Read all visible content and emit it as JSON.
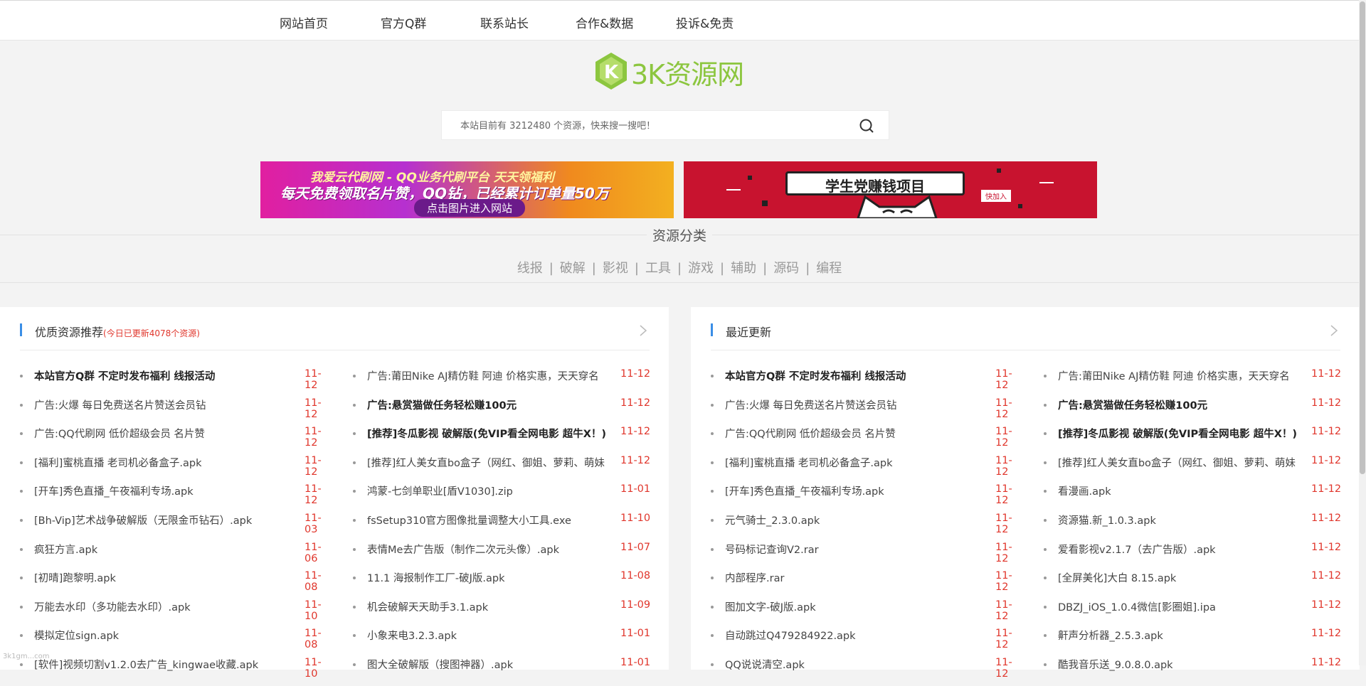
{
  "nav": {
    "items": [
      {
        "label": "网站首页"
      },
      {
        "label": "官方Q群"
      },
      {
        "label": "联系站长"
      },
      {
        "label": "合作&数据"
      },
      {
        "label": "投诉&免责"
      }
    ]
  },
  "logo": {
    "text": "3K资源网",
    "mark": "K",
    "color": "#8cc63f"
  },
  "search": {
    "placeholder": "本站目前有 3212480 个资源，快来搜一搜吧！",
    "icon": "search-icon"
  },
  "banners": {
    "b1": {
      "line1": "我爱云代刷网 - QQ业务代刷平台   天天领福利",
      "line2": "每天免费领取名片赞，QQ钻，已经累计订单量50万",
      "button": "点击图片进入网站"
    },
    "b2": {
      "text": "学生党赚钱项目",
      "tag": "快加入"
    }
  },
  "categories": {
    "title": "资源分类",
    "links": [
      "线报",
      "破解",
      "影视",
      "工具",
      "游戏",
      "辅助",
      "源码",
      "编程"
    ]
  },
  "left_panel": {
    "title": "优质资源推荐",
    "subtitle": "(今日已更新4078个资源)",
    "col_a": [
      {
        "title": "本站官方Q群 不定时发布福利 线报活动",
        "date": "11-12",
        "bold": true
      },
      {
        "title": "广告:火爆 每日免费送名片赞送会员钻",
        "date": "11-12"
      },
      {
        "title": "广告:QQ代刷网  低价超级会员 名片赞",
        "date": "11-12"
      },
      {
        "title": "[福利]蜜桃直播 老司机必备盒子.apk",
        "date": "11-12"
      },
      {
        "title": "[开车]秀色直播_午夜福利专场.apk",
        "date": "11-12"
      },
      {
        "title": "[Bh-Vip]艺术战争破解版（无限金币钻石）.apk",
        "date": "11-03"
      },
      {
        "title": "疯狂方言.apk",
        "date": "11-06"
      },
      {
        "title": "[初晴]跑黎明.apk",
        "date": "11-08"
      },
      {
        "title": "万能去水印（多功能去水印）.apk",
        "date": "11-10"
      },
      {
        "title": "模拟定位sign.apk",
        "date": "11-08"
      },
      {
        "title": "[软件]视频切割v1.2.0去广告_kingwae收藏.apk",
        "date": "11-10"
      }
    ],
    "col_b": [
      {
        "title": "广告:莆田Nike AJ精仿鞋 阿迪 价格实惠，天天穿名",
        "date": "11-12"
      },
      {
        "title": "广告:悬赏猫做任务轻松赚100元",
        "date": "11-12",
        "bold": true
      },
      {
        "title": "[推荐]冬瓜影视 破解版(免VIP看全网电影 超牛X！)",
        "date": "11-12",
        "bold": true
      },
      {
        "title": "[推荐]红人美女直bo盒子（网红、御姐、萝莉、萌妹",
        "date": "11-12"
      },
      {
        "title": "鸿蒙-七剑单职业[盾V1030].zip",
        "date": "11-01"
      },
      {
        "title": "fsSetup310官方图像批量调整大小工具.exe",
        "date": "11-10"
      },
      {
        "title": "表情Me去广告版（制作二次元头像）.apk",
        "date": "11-07"
      },
      {
        "title": "11.1 海报制作工厂-破J版.apk",
        "date": "11-08"
      },
      {
        "title": "机会破解天天助手3.1.apk",
        "date": "11-09"
      },
      {
        "title": "小象来电3.2.3.apk",
        "date": "11-01"
      },
      {
        "title": "图大全破解版（搜图神器）.apk",
        "date": "11-01"
      }
    ]
  },
  "right_panel": {
    "title": "最近更新",
    "col_a": [
      {
        "title": "本站官方Q群 不定时发布福利 线报活动",
        "date": "11-12",
        "bold": true
      },
      {
        "title": "广告:火爆 每日免费送名片赞送会员钻",
        "date": "11-12"
      },
      {
        "title": "广告:QQ代刷网  低价超级会员 名片赞",
        "date": "11-12"
      },
      {
        "title": "[福利]蜜桃直播 老司机必备盒子.apk",
        "date": "11-12"
      },
      {
        "title": "[开车]秀色直播_午夜福利专场.apk",
        "date": "11-12"
      },
      {
        "title": "元气骑士_2.3.0.apk",
        "date": "11-12"
      },
      {
        "title": "号码标记查询V2.rar",
        "date": "11-12"
      },
      {
        "title": "内部程序.rar",
        "date": "11-12"
      },
      {
        "title": "图加文字-破J版.apk",
        "date": "11-12"
      },
      {
        "title": "自动跳过Q479284922.apk",
        "date": "11-12"
      },
      {
        "title": "QQ说说清空.apk",
        "date": "11-12"
      }
    ],
    "col_b": [
      {
        "title": "广告:莆田Nike AJ精仿鞋 阿迪 价格实惠，天天穿名",
        "date": "11-12"
      },
      {
        "title": "广告:悬赏猫做任务轻松赚100元",
        "date": "11-12",
        "bold": true
      },
      {
        "title": "[推荐]冬瓜影视 破解版(免VIP看全网电影 超牛X！)",
        "date": "11-12",
        "bold": true
      },
      {
        "title": "[推荐]红人美女直bo盒子（网红、御姐、萝莉、萌妹",
        "date": "11-12"
      },
      {
        "title": "看漫画.apk",
        "date": "11-12"
      },
      {
        "title": "资源猫.新_1.0.3.apk",
        "date": "11-12"
      },
      {
        "title": "爱看影视v2.1.7（去广告版）.apk",
        "date": "11-12"
      },
      {
        "title": "[全屏美化]大白 8.15.apk",
        "date": "11-12"
      },
      {
        "title": "DBZJ_iOS_1.0.4微信[影圈姐].ipa",
        "date": "11-12"
      },
      {
        "title": "鼾声分析器_2.5.3.apk",
        "date": "11-12"
      },
      {
        "title": "酷我音乐送_9.0.8.0.apk",
        "date": "11-12"
      }
    ]
  },
  "watermark": "3k1gm...com"
}
